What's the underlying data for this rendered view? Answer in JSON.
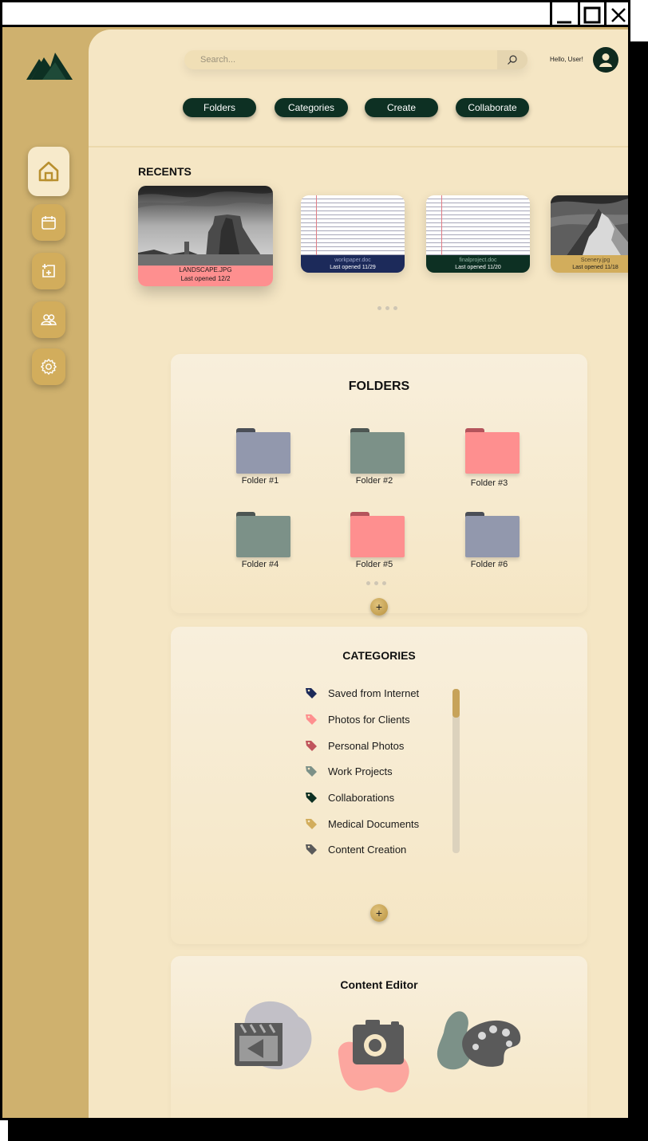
{
  "window": {
    "minimize": "minimize",
    "maximize": "maximize",
    "close": "close"
  },
  "header": {
    "search_placeholder": "Search...",
    "greeting": "Hello, User!",
    "nav_pills": [
      "Folders",
      "Categories",
      "Create",
      "Collaborate"
    ]
  },
  "sidebar": {
    "items": [
      {
        "icon": "home-icon",
        "active": true
      },
      {
        "icon": "calendar-icon",
        "active": false
      },
      {
        "icon": "add-file-icon",
        "active": false
      },
      {
        "icon": "users-icon",
        "active": false
      },
      {
        "icon": "settings-icon",
        "active": false
      }
    ]
  },
  "recents": {
    "title": "RECENTS",
    "items": [
      {
        "name": "LANDSCAPE.JPG",
        "opened": "Last opened 12/2",
        "color": "#fe8f8f"
      },
      {
        "name": "workpaper.doc",
        "opened": "Last opened 11/29",
        "color": "#1c2a5a"
      },
      {
        "name": "finalproject.doc",
        "opened": "Last opened 11/20",
        "color": "#0d3023"
      },
      {
        "name": "Scenery.jpg",
        "opened": "Last opened 11/18",
        "color": "#d2ad5c"
      }
    ]
  },
  "folders": {
    "title": "FOLDERS",
    "items": [
      {
        "label": "Folder #1",
        "color": "#9298ad"
      },
      {
        "label": "Folder #2",
        "color": "#7c9188"
      },
      {
        "label": "Folder #3",
        "color": "#fe8f8f"
      },
      {
        "label": "Folder #4",
        "color": "#7c9188"
      },
      {
        "label": "Folder #5",
        "color": "#fe8f8f"
      },
      {
        "label": "Folder #6",
        "color": "#9298ad"
      }
    ],
    "add_label": "+"
  },
  "categories": {
    "title": "CATEGORIES",
    "items": [
      {
        "label": "Saved from Internet",
        "color": "#1c2a5a"
      },
      {
        "label": "Photos for Clients",
        "color": "#fe8f8f"
      },
      {
        "label": "Personal Photos",
        "color": "#c0545c"
      },
      {
        "label": "Work Projects",
        "color": "#7c9188"
      },
      {
        "label": "Collaborations",
        "color": "#0d3023"
      },
      {
        "label": "Medical Documents",
        "color": "#d2ad5c"
      },
      {
        "label": "Content Creation",
        "color": "#5a5a5a"
      }
    ],
    "add_label": "+"
  },
  "content_editor": {
    "title": "Content Editor",
    "tools": [
      "video-editor-icon",
      "photo-editor-icon",
      "paint-palette-icon"
    ]
  }
}
